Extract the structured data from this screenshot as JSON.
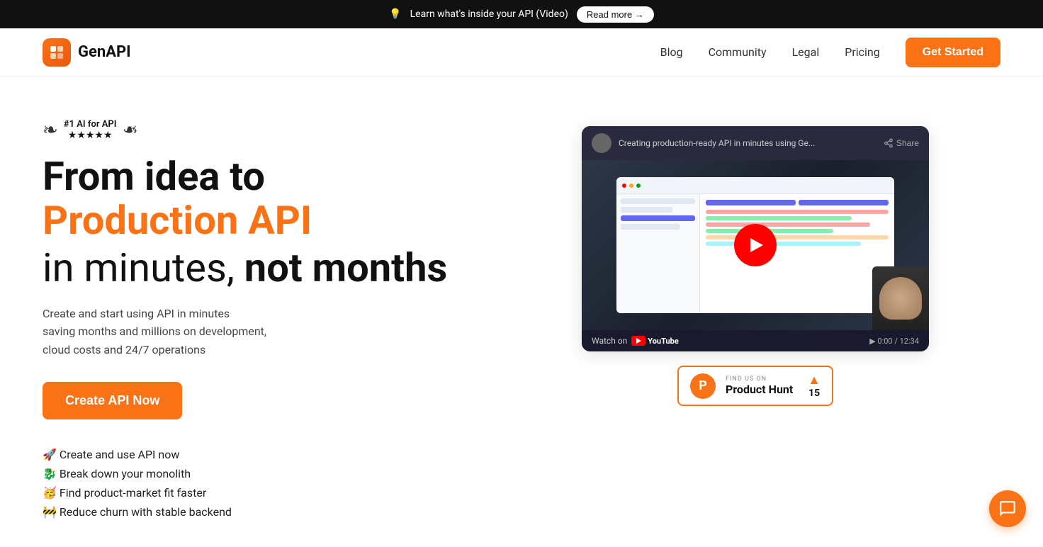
{
  "banner": {
    "icon": "💡",
    "text": "Learn what's inside your API (Video)",
    "cta": "Read more →"
  },
  "nav": {
    "logo_text": "GenAPI",
    "links": [
      {
        "label": "Blog",
        "id": "blog"
      },
      {
        "label": "Community",
        "id": "community"
      },
      {
        "label": "Legal",
        "id": "legal"
      },
      {
        "label": "Pricing",
        "id": "pricing"
      }
    ],
    "cta": "Get Started"
  },
  "hero": {
    "award": {
      "text": "#1 AI for API",
      "stars": "★★★★★"
    },
    "headline_line1": "From idea to",
    "headline_orange": "Production API",
    "headline_line3_normal": "in minutes, ",
    "headline_line3_bold": "not months",
    "description_line1": "Create and start using API in minutes",
    "description_line2": "saving months and millions on development,",
    "description_line3": "cloud costs and 24/7 operations",
    "cta": "Create API Now",
    "features": [
      "🚀 Create and use API now",
      "🐉 Break down your monolith",
      "🥳 Find product-market fit faster",
      "🚧 Reduce churn with stable backend"
    ]
  },
  "video": {
    "title": "Creating production-ready API in minutes using Ge...",
    "share_label": "Share",
    "watch_on": "Watch on",
    "youtube": "YouTube"
  },
  "product_hunt": {
    "find_us": "FIND US ON",
    "name": "Product Hunt",
    "votes": "15"
  },
  "chat_icon": "chat-icon",
  "colors": {
    "orange": "#f97316",
    "dark": "#111111",
    "text": "#333333"
  }
}
